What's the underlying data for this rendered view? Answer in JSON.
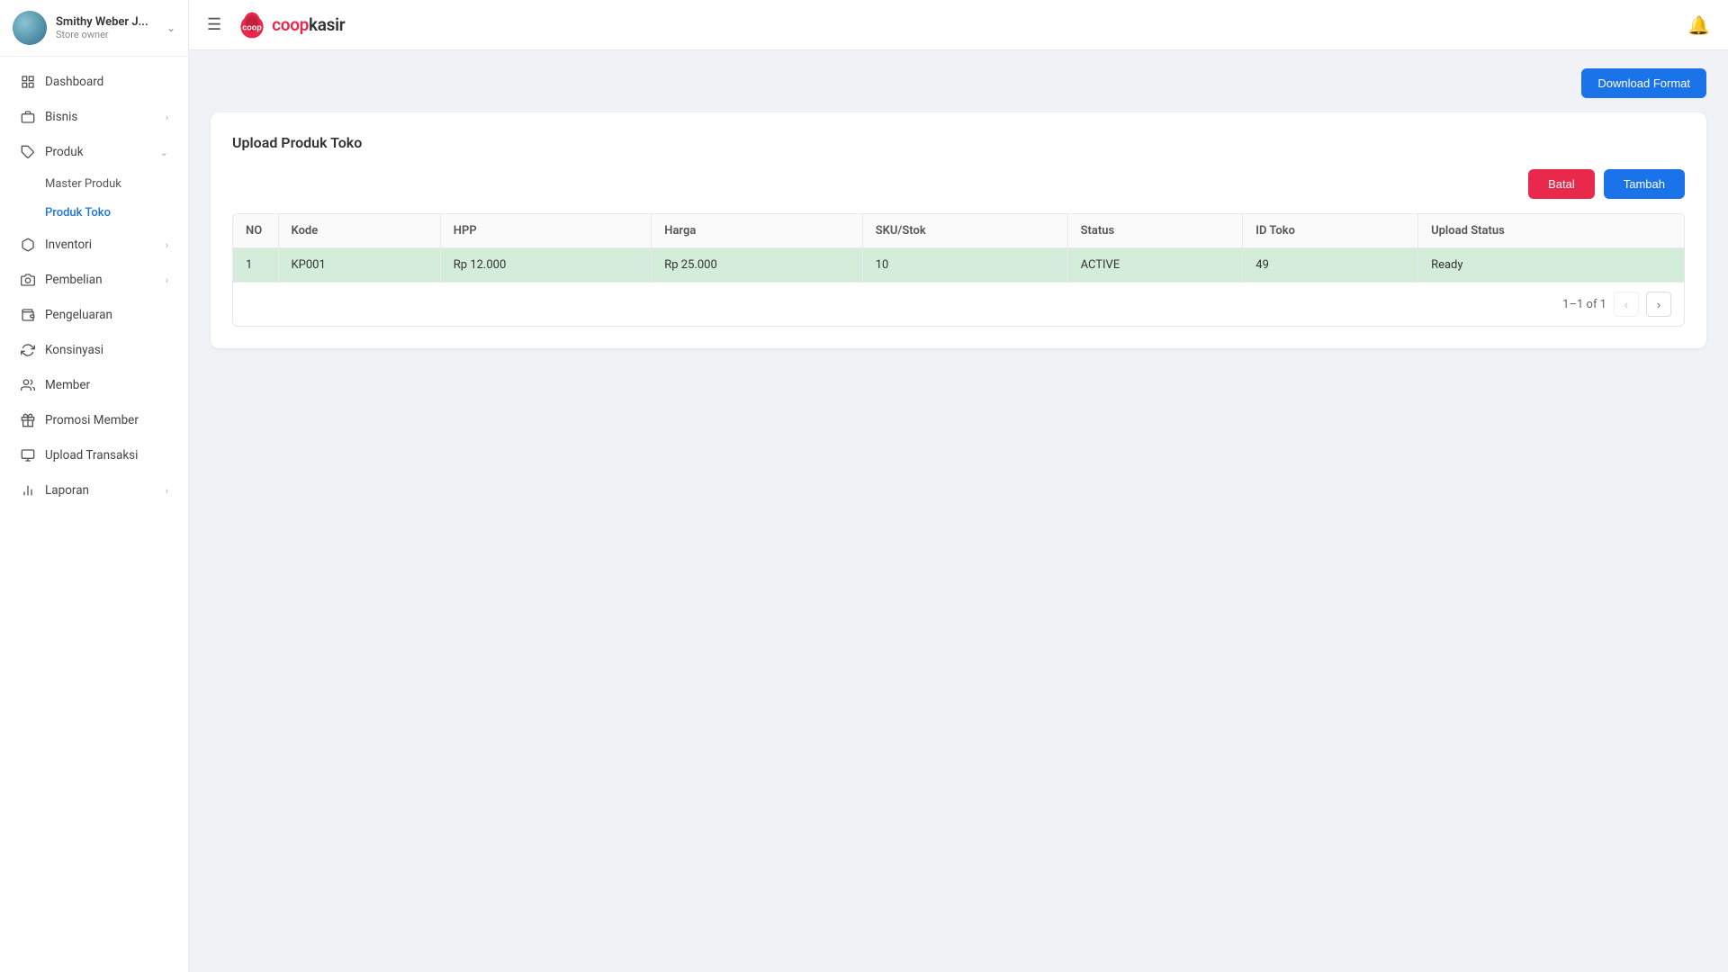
{
  "sidebar": {
    "user": {
      "name": "Smithy Weber J...",
      "full_name": "Smithy Weber Store owner",
      "role": "Store owner"
    },
    "items": [
      {
        "id": "dashboard",
        "label": "Dashboard",
        "icon": "grid-icon",
        "hasArrow": false,
        "hasSubmenu": false
      },
      {
        "id": "bisnis",
        "label": "Bisnis",
        "icon": "briefcase-icon",
        "hasArrow": true,
        "hasSubmenu": false
      },
      {
        "id": "produk",
        "label": "Produk",
        "icon": "tag-icon",
        "hasArrow": true,
        "hasSubmenu": true,
        "submenu": [
          {
            "id": "master-produk",
            "label": "Master Produk"
          },
          {
            "id": "produk-toko",
            "label": "Produk Toko"
          }
        ]
      },
      {
        "id": "inventori",
        "label": "Inventori",
        "icon": "box-icon",
        "hasArrow": true,
        "hasSubmenu": false
      },
      {
        "id": "pembelian",
        "label": "Pembelian",
        "icon": "camera-icon",
        "hasArrow": true,
        "hasSubmenu": false
      },
      {
        "id": "pengeluaran",
        "label": "Pengeluaran",
        "icon": "wallet-icon",
        "hasArrow": false,
        "hasSubmenu": false
      },
      {
        "id": "konsinyasi",
        "label": "Konsinyasi",
        "icon": "refresh-icon",
        "hasArrow": false,
        "hasSubmenu": false
      },
      {
        "id": "member",
        "label": "Member",
        "icon": "users-icon",
        "hasArrow": false,
        "hasSubmenu": false
      },
      {
        "id": "promosi-member",
        "label": "Promosi Member",
        "icon": "gift-icon",
        "hasArrow": false,
        "hasSubmenu": false
      },
      {
        "id": "upload-transaksi",
        "label": "Upload Transaksi",
        "icon": "upload-icon",
        "hasArrow": false,
        "hasSubmenu": false
      },
      {
        "id": "laporan",
        "label": "Laporan",
        "icon": "chart-icon",
        "hasArrow": true,
        "hasSubmenu": false
      }
    ]
  },
  "topbar": {
    "logo_text_coop": "coop",
    "logo_text_kasir": "kasir"
  },
  "content": {
    "download_button": "Download Format",
    "card_title": "Upload Produk Toko",
    "batal_button": "Batal",
    "tambah_button": "Tambah",
    "table": {
      "columns": [
        "NO",
        "Kode",
        "HPP",
        "Harga",
        "SKU/Stok",
        "Status",
        "ID Toko",
        "Upload Status"
      ],
      "rows": [
        {
          "no": "1",
          "kode": "KP001",
          "hpp": "Rp 12.000",
          "harga": "Rp 25.000",
          "sku_stok": "10",
          "status": "ACTIVE",
          "id_toko": "49",
          "upload_status": "Ready",
          "highlight": true
        }
      ]
    },
    "pagination": {
      "info": "1–1 of 1"
    }
  }
}
